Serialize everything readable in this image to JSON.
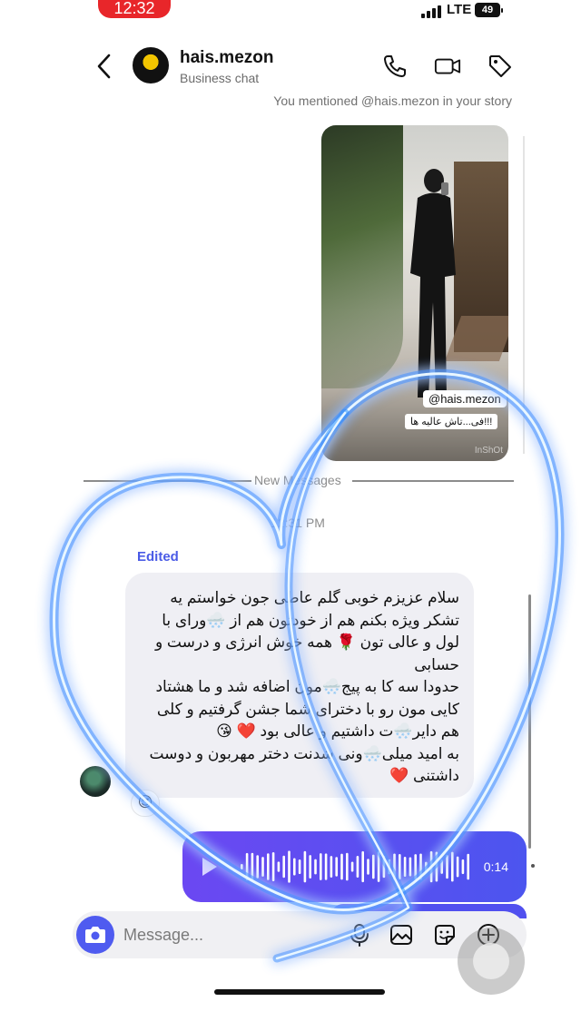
{
  "status_bar": {
    "time": "12:32",
    "network": "LTE",
    "battery": "49"
  },
  "header": {
    "username": "hais.mezon",
    "subtitle": "Business chat",
    "icons": [
      "back-chevron-icon",
      "phone-icon",
      "video-camera-icon",
      "tag-icon"
    ]
  },
  "thread": {
    "mention_note": "You mentioned @hais.mezon in your story",
    "story": {
      "tag": "@hais.mezon",
      "caption": "فی...تاش عالیه ها!!!",
      "watermark": "InShOt"
    },
    "new_messages_label": "New Messages",
    "timestamp": "12:31 PM",
    "edited_label": "Edited",
    "incoming_text": "سلام عزیزم خوبی گلم عاطی جون خواستم یه تشکر ویژه بکنم هم از خودتون هم از 🌨️ورای با لول و عالی تون 🌹 همه خوش انرژی و درست و حسابی\nحدودا سه کا به پیج🌨️مون اضافه شد و ما هشتاد کایی مون رو با دخترای شما جشن گرفتیم و کلی هم دایر🌨️ت داشتیم و عالی بود ❤️ 😘\nبه امید میلی🌨️ونی شدنت دختر مهربون و دوست داشتنی ❤️",
    "reaction": "😍",
    "voice_duration": "0:14"
  },
  "composer": {
    "placeholder": "Message...",
    "icons": [
      "camera-icon",
      "microphone-icon",
      "gallery-icon",
      "sticker-icon",
      "plus-icon"
    ]
  },
  "colors": {
    "accent": "#4f5bf0",
    "voice_start": "#6b48f2",
    "voice_end": "#4c55ef",
    "status_red": "#e8262a",
    "neon": "#33a6ff"
  }
}
